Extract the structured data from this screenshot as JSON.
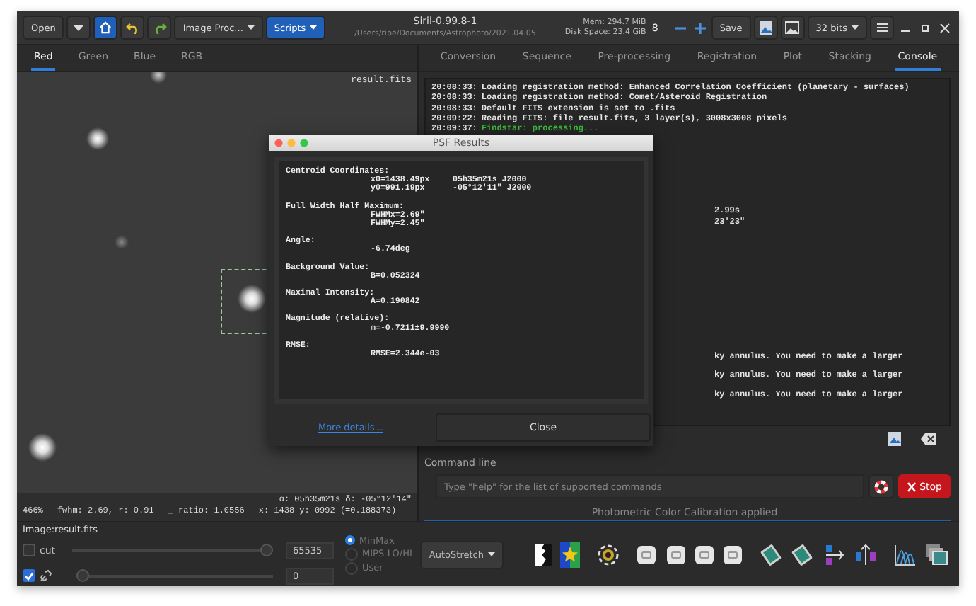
{
  "header": {
    "open_button": "Open",
    "image_processing_menu": "Image Proc...",
    "scripts_menu": "Scripts",
    "title": "Siril-0.99.8-1",
    "path": "/Users/ribe/Documents/Astrophoto/2021.04.05",
    "memory": "Mem: 294.7 MiB",
    "disk_space": "Disk Space: 23.4 GiB",
    "zoom_value": "8",
    "save_button": "Save",
    "bit_depth": "32 bits"
  },
  "channel_tabs": [
    {
      "label": "Red",
      "selected": true
    },
    {
      "label": "Green",
      "selected": false
    },
    {
      "label": "Blue",
      "selected": false
    },
    {
      "label": "RGB",
      "selected": false
    }
  ],
  "image": {
    "filename": "result.fits"
  },
  "status": {
    "coordinates": "α: 05h35m21s δ: -05°12'14\"",
    "zoom": "466%",
    "fwhm": "fwhm: 2.69, r: 0.91",
    "ratio": "_ ratio: 1.0556",
    "pixel": "x: 1438 y: 0992 (=0.188373)"
  },
  "image_label": "Image:result.fits",
  "controls": {
    "cut_checkbox": {
      "label": "cut",
      "checked": false
    },
    "link_checkbox": {
      "checked": true
    },
    "high_slider": {
      "level": 1,
      "value": "65535"
    },
    "low_slider": {
      "level": 0,
      "value": "0"
    },
    "scaling": [
      {
        "label": "MinMax",
        "selected": true
      },
      {
        "label": "MIPS-LO/HI",
        "selected": false
      },
      {
        "label": "User",
        "selected": false
      }
    ],
    "stretch_menu": "AutoStretch"
  },
  "panel_tabs": [
    {
      "label": "Conversion",
      "selected": false
    },
    {
      "label": "Sequence",
      "selected": false
    },
    {
      "label": "Pre-processing",
      "selected": false
    },
    {
      "label": "Registration",
      "selected": false
    },
    {
      "label": "Plot",
      "selected": false
    },
    {
      "label": "Stacking",
      "selected": false
    },
    {
      "label": "Console",
      "selected": true
    }
  ],
  "console": [
    {
      "kind": "log",
      "time": "20:08:33:",
      "text": "Loading registration method: Enhanced Correlation Coefficient (planetary - surfaces)"
    },
    {
      "kind": "log",
      "time": "20:08:33:",
      "text": "Loading registration method: Comet/Asteroid Registration"
    },
    {
      "kind": "log",
      "time": "20:08:33:",
      "text": "Default FITS extension is set to .fits"
    },
    {
      "kind": "log",
      "time": "20:09:22:",
      "text": "Reading FITS: file result.fits, 3 layer(s), 3008x3008 pixels"
    },
    {
      "kind": "success",
      "time": "20:09:37:",
      "text": "Findstar: processing..."
    },
    {
      "kind": "partial",
      "text": "2.99s"
    },
    {
      "kind": "partial",
      "text": "23'23\""
    },
    {
      "kind": "partial",
      "text": "ky annulus. You need to make a larger"
    },
    {
      "kind": "partial",
      "text": "ky annulus. You need to make a larger"
    },
    {
      "kind": "partial",
      "text": "ky annulus. You need to make a larger"
    }
  ],
  "command_line": {
    "label": "Command line",
    "placeholder": "Type \"help\" for the list of supported commands",
    "stop_button": "Stop"
  },
  "status_message": "Photometric Color Calibration applied",
  "psf_dialog": {
    "title": "PSF Results",
    "sections": [
      {
        "label": "Centroid Coordinates:",
        "rows": [
          {
            "value": "x0=1438.49px",
            "extra": "05h35m21s J2000"
          },
          {
            "value": "y0=991.19px",
            "extra": "-05°12'11\" J2000"
          }
        ]
      },
      {
        "label": "Full Width Half Maximum:",
        "rows": [
          {
            "value": "FWHMx=2.69\""
          },
          {
            "value": "FWHMy=2.45\""
          }
        ]
      },
      {
        "label": "Angle:",
        "rows": [
          {
            "value": "-6.74deg"
          }
        ]
      },
      {
        "label": "Background Value:",
        "rows": [
          {
            "value": "B=0.052324"
          }
        ]
      },
      {
        "label": "Maximal Intensity:",
        "rows": [
          {
            "value": "A=0.190842"
          }
        ]
      },
      {
        "label": "Magnitude (relative):",
        "rows": [
          {
            "value": "m=-0.7211±9.9990"
          }
        ]
      },
      {
        "label": "RMSE:",
        "rows": [
          {
            "value": "RMSE=2.344e-03"
          }
        ]
      }
    ],
    "link": "More details...",
    "close_button": "Close"
  }
}
